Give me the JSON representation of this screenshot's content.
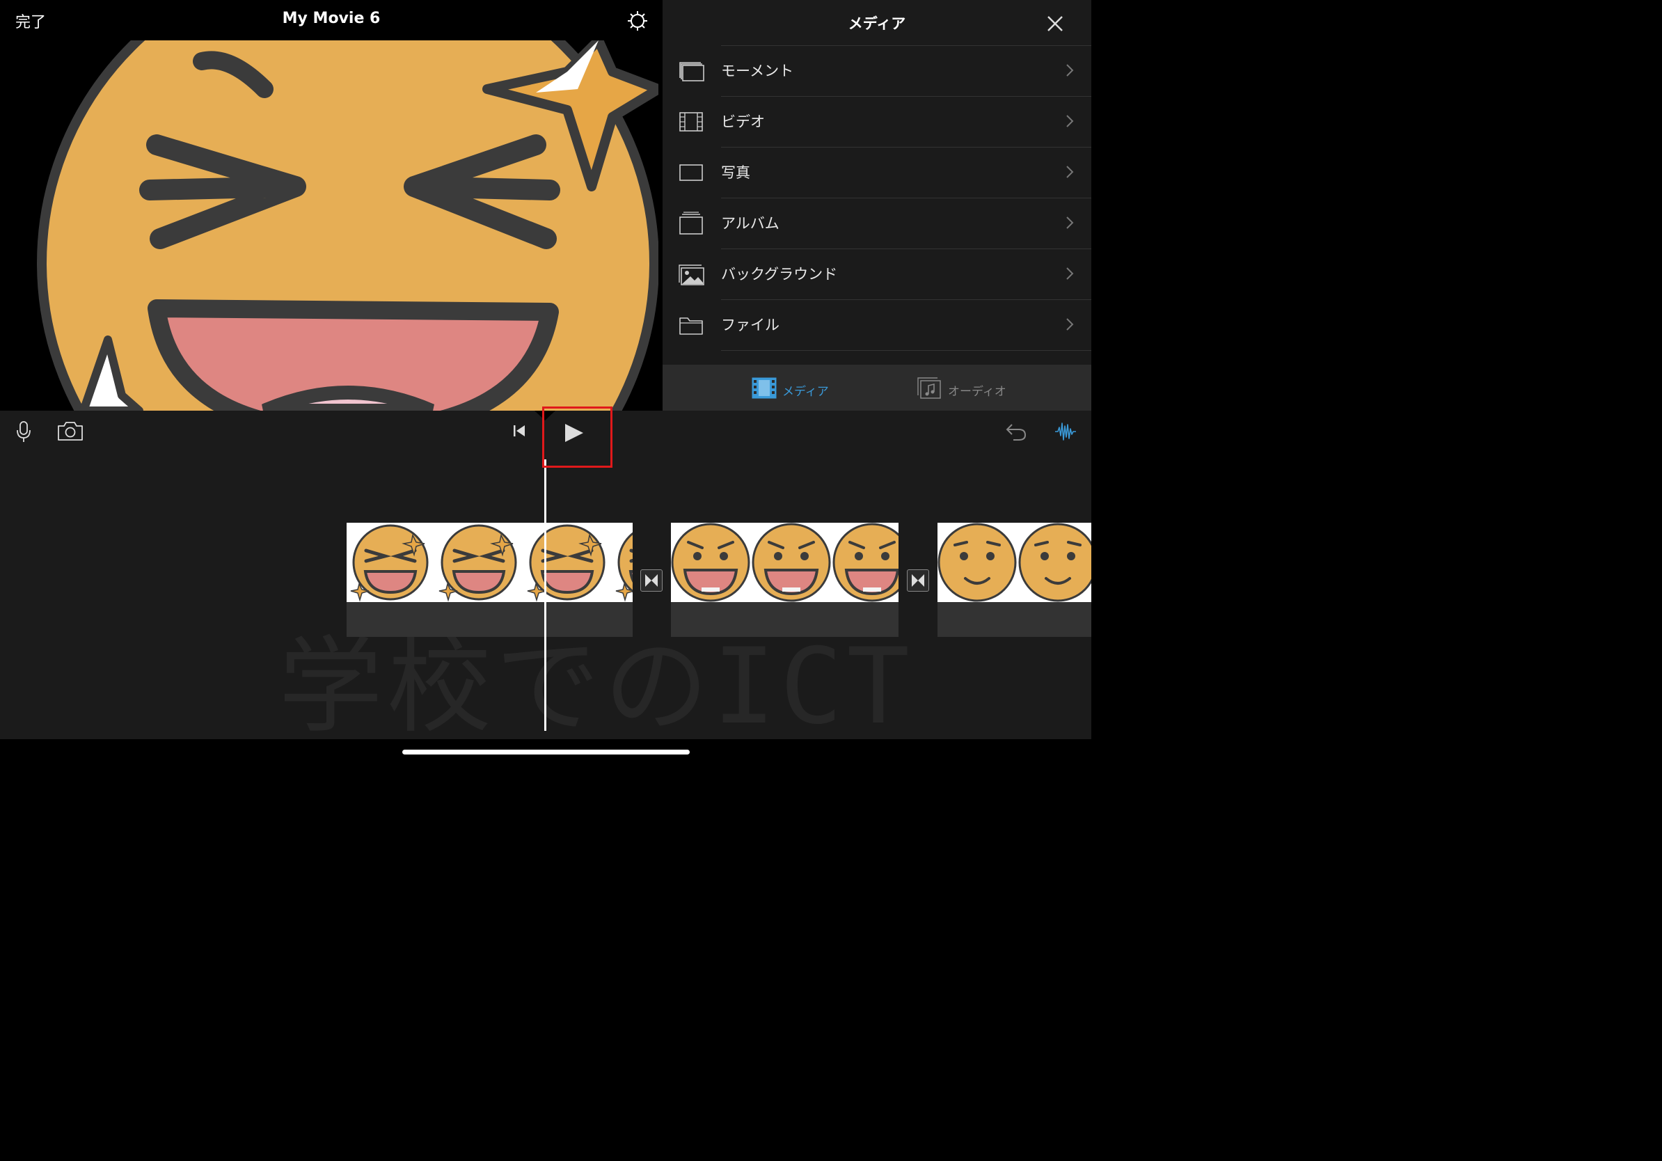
{
  "viewer": {
    "done_label": "完了",
    "title": "My Movie 6"
  },
  "media_panel": {
    "title": "メディア",
    "items": [
      {
        "label": "モーメント",
        "icon": "moments-icon"
      },
      {
        "label": "ビデオ",
        "icon": "video-film-icon"
      },
      {
        "label": "写真",
        "icon": "photo-icon"
      },
      {
        "label": "アルバム",
        "icon": "album-icon"
      },
      {
        "label": "バックグラウンド",
        "icon": "background-image-icon"
      },
      {
        "label": "ファイル",
        "icon": "folder-icon"
      }
    ],
    "tabs": [
      {
        "label": "メディア",
        "active": true
      },
      {
        "label": "オーディオ",
        "active": false
      }
    ]
  },
  "timeline": {
    "watermark": "学校でのICT"
  },
  "colors": {
    "accent_blue": "#3a9ad9",
    "highlight_red": "#e0191b",
    "emoji_orange": "#e6ae55",
    "panel_bg": "#1b1b1b"
  }
}
